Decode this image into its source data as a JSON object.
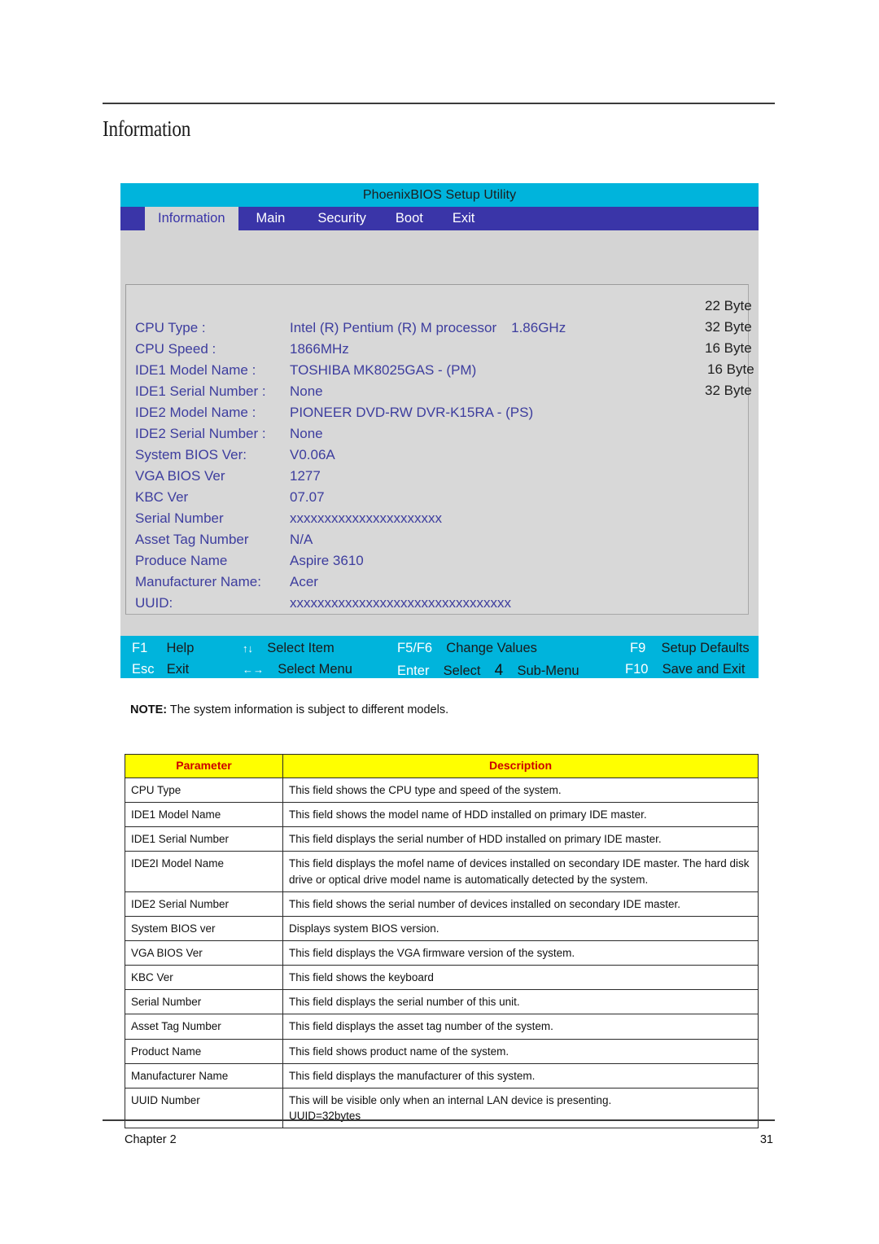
{
  "page": {
    "title": "Information",
    "note_prefix": "NOTE:",
    "note_text": " The system information is subject to different models.",
    "footer_left": "Chapter 2",
    "footer_right": "31"
  },
  "bios": {
    "utility_title": "PhoenixBIOS Setup Utility",
    "tabs": [
      {
        "label": "Information",
        "active": true
      },
      {
        "label": "Main",
        "active": false
      },
      {
        "label": "Security",
        "active": false
      },
      {
        "label": "Boot",
        "active": false
      },
      {
        "label": "Exit",
        "active": false
      }
    ],
    "fields": [
      {
        "label": "CPU Type :",
        "value": "Intel (R) Pentium (R) M processor",
        "value2": "1.86GHz"
      },
      {
        "label": "CPU Speed :",
        "value": "1866MHz",
        "value2": ""
      },
      {
        "label": "IDE1 Model Name :",
        "value": "TOSHIBA MK8025GAS - (PM)",
        "value2": ""
      },
      {
        "label": "IDE1 Serial Number :",
        "value": "None",
        "value2": ""
      },
      {
        "label": "IDE2 Model Name :",
        "value": "PIONEER DVD-RW DVR-K15RA - (PS)",
        "value2": ""
      },
      {
        "label": "IDE2 Serial Number :",
        "value": "None",
        "value2": ""
      },
      {
        "label": "System BIOS Ver:",
        "value": "V0.06A",
        "value2": ""
      },
      {
        "label": "VGA BIOS Ver",
        "value": "1277",
        "value2": ""
      },
      {
        "label": "KBC Ver",
        "value": "07.07",
        "value2": ""
      },
      {
        "label": "Serial Number",
        "value": "xxxxxxxxxxxxxxxxxxxxxx",
        "value2": ""
      },
      {
        "label": "Asset Tag Number",
        "value": "N/A",
        "value2": ""
      },
      {
        "label": "Produce Name",
        "value": "Aspire 3610",
        "value2": ""
      },
      {
        "label": "Manufacturer Name:",
        "value": "Acer",
        "value2": ""
      },
      {
        "label": "UUID:",
        "value": "xxxxxxxxxxxxxxxxxxxxxxxxxxxxxxxx",
        "value2": ""
      }
    ],
    "byte_notes": [
      "22 Byte",
      "32 Byte",
      "16 Byte",
      "16 Byte",
      "32 Byte"
    ],
    "fkeys_row1": [
      {
        "key": "F1",
        "desc": "Help"
      },
      {
        "key": "↑↓",
        "desc": "Select Item"
      },
      {
        "key": "F5/F6",
        "desc": "Change Values"
      },
      {
        "key": "F9",
        "desc": "Setup Defaults"
      }
    ],
    "fkeys_row2": [
      {
        "key": "Esc",
        "desc": "Exit"
      },
      {
        "key": "←→",
        "desc": "Select Menu"
      },
      {
        "key": "Enter",
        "desc": "Select"
      },
      {
        "key": "F10",
        "desc": "Save and Exit"
      }
    ],
    "submenu_glyph": "4",
    "submenu_label": "Sub-Menu"
  },
  "table": {
    "headers": [
      "Parameter",
      "Description"
    ],
    "rows": [
      {
        "parameter": "CPU Type",
        "description": "This field shows the CPU type and speed of the system."
      },
      {
        "parameter": "IDE1 Model Name",
        "description": "This field shows the model name of HDD installed on primary IDE master."
      },
      {
        "parameter": "IDE1 Serial Number",
        "description": "This field displays the serial number of HDD installed on primary IDE master."
      },
      {
        "parameter": "IDE2I Model Name",
        "description": "This field displays the mofel name of devices installed on secondary IDE master. The hard disk drive or optical drive model name is automatically detected by the system."
      },
      {
        "parameter": "IDE2 Serial Number",
        "description": "This field shows the serial number of devices installed on secondary IDE master."
      },
      {
        "parameter": "System BIOS ver",
        "description": "Displays system BIOS version."
      },
      {
        "parameter": "VGA BIOS Ver",
        "description": "This field displays the VGA firmware version of the system."
      },
      {
        "parameter": "KBC Ver",
        "description": "This field shows the keyboard"
      },
      {
        "parameter": "Serial Number",
        "description": "This field displays the serial number of this unit."
      },
      {
        "parameter": "Asset Tag Number",
        "description": "This field displays the asset tag number of the system."
      },
      {
        "parameter": "Product Name",
        "description": "This field shows product name of the system."
      },
      {
        "parameter": "Manufacturer Name",
        "description": "This field displays the manufacturer of this system."
      },
      {
        "parameter": "UUID Number",
        "description": "This will be visible only when an internal LAN device is presenting.\nUUID=32bytes"
      }
    ]
  },
  "colors": {
    "bios_title_bar": "#00b4dc",
    "bios_menu_bar": "#3a35a8",
    "bios_body": "#d4d4d4",
    "bios_text": "#3d3d9e",
    "table_header_bg": "#ffff00",
    "table_header_fg": "#cc0000"
  }
}
